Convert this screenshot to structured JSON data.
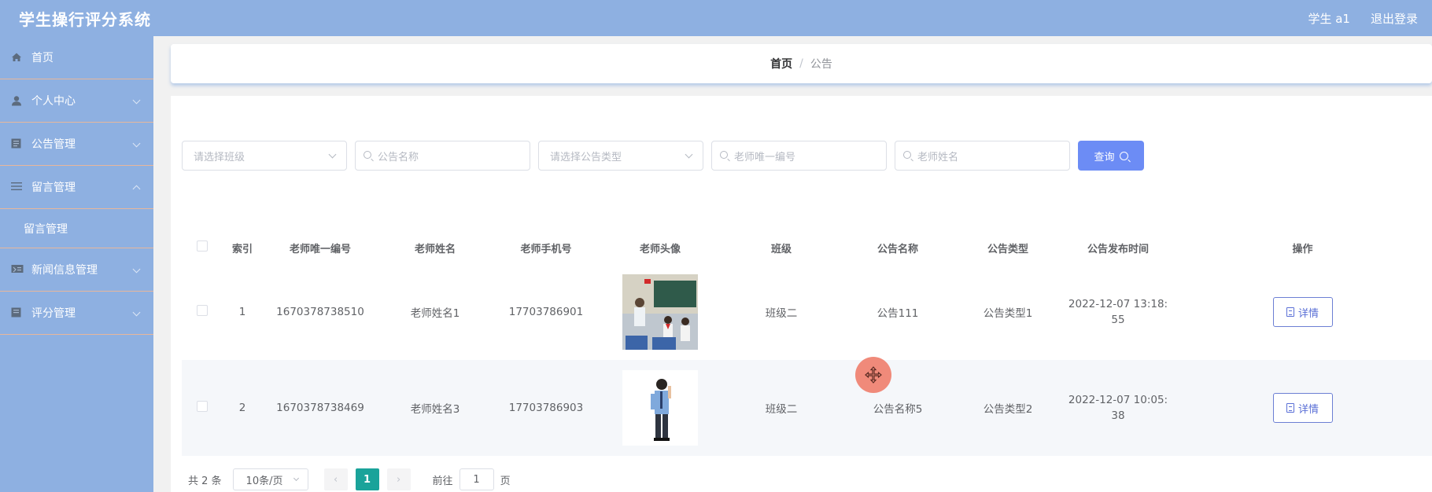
{
  "app": {
    "title": "学生操行评分系统"
  },
  "header": {
    "user": "学生 a1",
    "logout": "退出登录"
  },
  "sidebar": {
    "items": [
      {
        "label": "首页",
        "icon": "home-icon"
      },
      {
        "label": "个人中心",
        "icon": "user-icon"
      },
      {
        "label": "公告管理",
        "icon": "notice-icon"
      },
      {
        "label": "留言管理",
        "icon": "list-icon"
      },
      {
        "label": "留言管理",
        "icon": ""
      },
      {
        "label": "新闻信息管理",
        "icon": "news-icon"
      },
      {
        "label": "评分管理",
        "icon": "score-icon"
      }
    ]
  },
  "breadcrumb": {
    "home": "首页",
    "separator": "/",
    "current": "公告"
  },
  "filters": {
    "class_placeholder": "请选择班级",
    "notice_name_placeholder": "公告名称",
    "notice_type_placeholder": "请选择公告类型",
    "teacher_id_placeholder": "老师唯一编号",
    "teacher_name_placeholder": "老师姓名",
    "query_label": "查询"
  },
  "table": {
    "headers": [
      "索引",
      "老师唯一编号",
      "老师姓名",
      "老师手机号",
      "老师头像",
      "班级",
      "公告名称",
      "公告类型",
      "公告发布时间",
      "操作"
    ],
    "rows": [
      {
        "index": "1",
        "teacher_id": "1670378738510",
        "teacher_name": "老师姓名1",
        "phone": "17703786901",
        "class": "班级二",
        "notice_name": "公告111",
        "notice_type": "公告类型1",
        "time_line1": "2022-12-07 13:18:",
        "time_line2": "55",
        "action": "详情"
      },
      {
        "index": "2",
        "teacher_id": "1670378738469",
        "teacher_name": "老师姓名3",
        "phone": "17703786903",
        "class": "班级二",
        "notice_name": "公告名称5",
        "notice_type": "公告类型2",
        "time_line1": "2022-12-07 10:05:",
        "time_line2": "38",
        "action": "详情"
      }
    ]
  },
  "pagination": {
    "total": "共 2 条",
    "page_size": "10条/页",
    "prev": "‹",
    "current_page": "1",
    "next": "›",
    "goto_label": "前往",
    "goto_value": "1",
    "page_unit": "页"
  },
  "colors": {
    "header_bg": "#8eb0e1",
    "sidebar_bg": "#8eb0e1",
    "sidebar_divider": "#e8b79b",
    "primary_button": "#6c8cf5",
    "active_page": "#1aa39a",
    "drag_handle": "#f08a7a"
  }
}
